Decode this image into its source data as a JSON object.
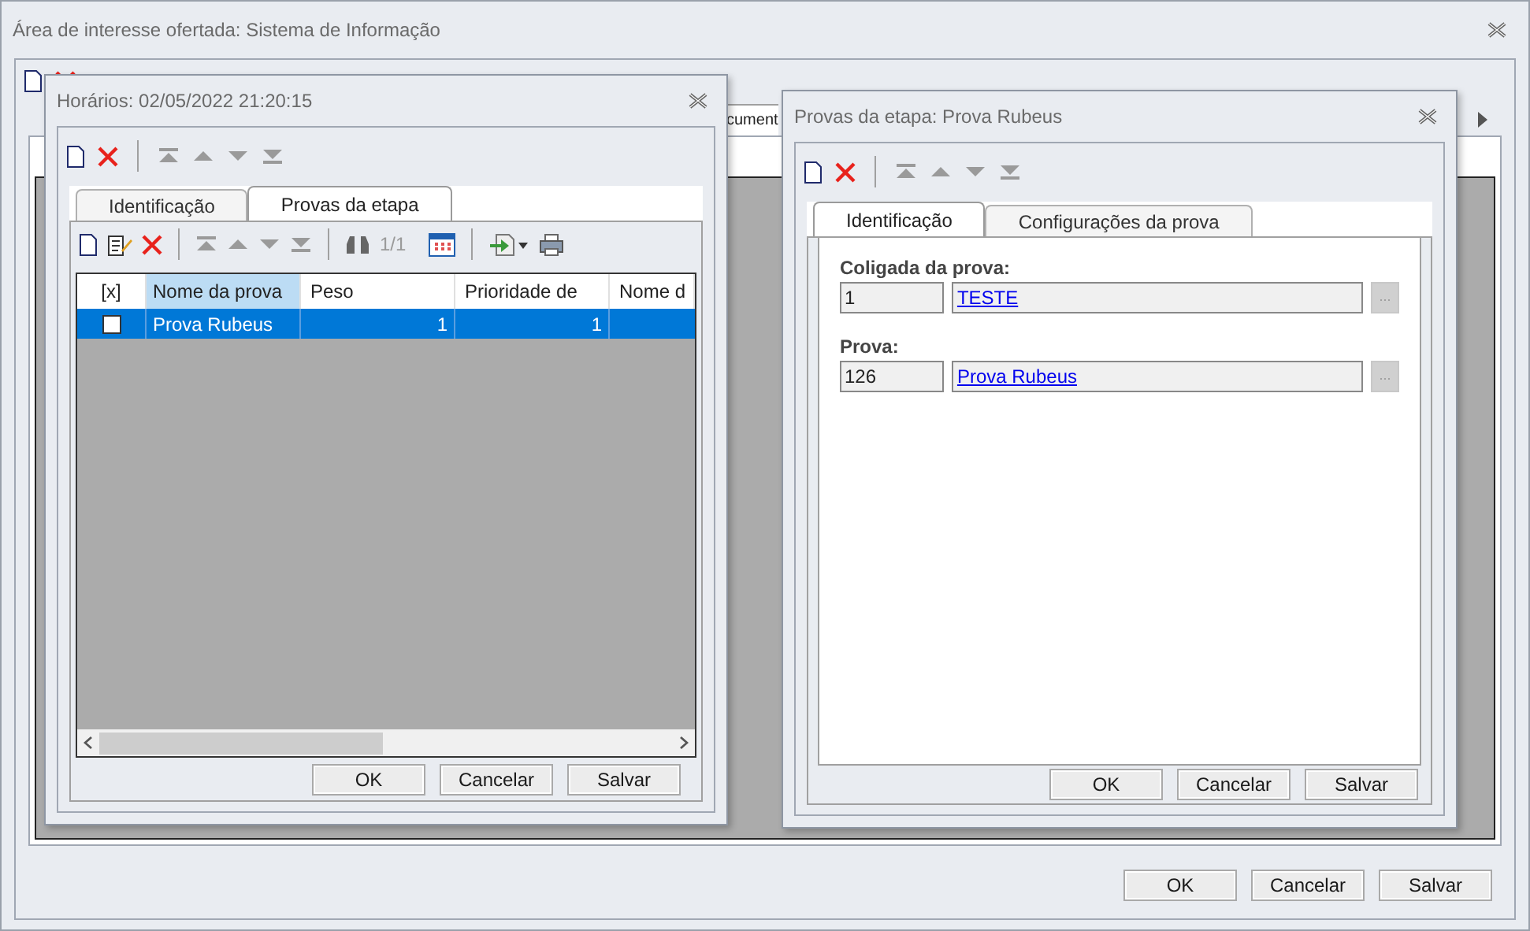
{
  "main_window": {
    "title": "Área de interesse ofertada: Sistema de Informação",
    "tab_fragment": "cument",
    "buttons": [
      "OK",
      "Cancelar",
      "Salvar"
    ]
  },
  "schedule_window": {
    "title": "Horários: 02/05/2022 21:20:15",
    "tabs": [
      {
        "label": "Identificação",
        "selected": false
      },
      {
        "label": "Provas da etapa",
        "selected": true
      }
    ],
    "record_counter": "1/1",
    "check_column": "[x]",
    "columns": [
      {
        "label": "Nome da prova",
        "highlighted": true
      },
      {
        "label": "Peso",
        "highlighted": false
      },
      {
        "label": "Prioridade de",
        "highlighted": false
      },
      {
        "label": "Nome d",
        "highlighted": false
      }
    ],
    "rows": [
      {
        "checked": false,
        "selected": true,
        "cells": [
          "Prova Rubeus",
          "1",
          "1"
        ]
      }
    ],
    "buttons": [
      "OK",
      "Cancelar",
      "Salvar"
    ]
  },
  "exam_window": {
    "title": "Provas da etapa: Prova Rubeus",
    "tabs": [
      {
        "label": "Identificação",
        "selected": true
      },
      {
        "label": "Configurações da prova",
        "selected": false
      }
    ],
    "fields": [
      {
        "label": "Coligada da prova:",
        "code": "1",
        "name": "TESTE",
        "lookup": "..."
      },
      {
        "label": "Prova:",
        "code": "126",
        "name": "Prova Rubeus",
        "lookup": "..."
      }
    ],
    "buttons": [
      "OK",
      "Cancelar",
      "Salvar"
    ]
  }
}
